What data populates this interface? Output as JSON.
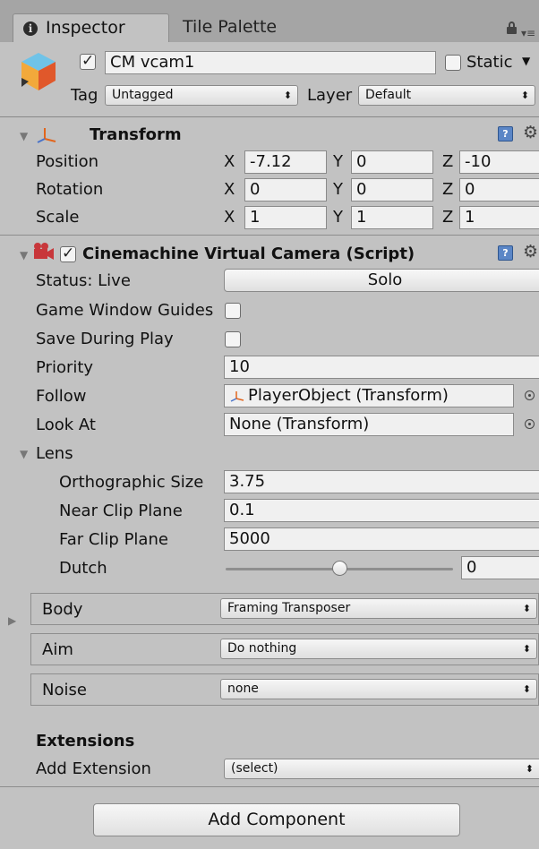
{
  "tabs": [
    {
      "label": "Inspector",
      "active": true
    },
    {
      "label": "Tile Palette",
      "active": false
    }
  ],
  "header": {
    "object_name": "CM vcam1",
    "active_checked": true,
    "static_label": "Static",
    "static_checked": false,
    "tag_label": "Tag",
    "tag_value": "Untagged",
    "layer_label": "Layer",
    "layer_value": "Default"
  },
  "transform": {
    "title": "Transform",
    "rows": [
      {
        "label": "Position",
        "x": "-7.12",
        "y": "0",
        "z": "-10"
      },
      {
        "label": "Rotation",
        "x": "0",
        "y": "0",
        "z": "0"
      },
      {
        "label": "Scale",
        "x": "1",
        "y": "1",
        "z": "1"
      }
    ],
    "axes": {
      "x": "X",
      "y": "Y",
      "z": "Z"
    }
  },
  "vcam": {
    "title": "Cinemachine Virtual Camera (Script)",
    "enabled": true,
    "status_label": "Status: Live",
    "solo_button": "Solo",
    "game_window_guides_label": "Game Window Guides",
    "game_window_guides_checked": false,
    "save_during_play_label": "Save During Play",
    "save_during_play_checked": false,
    "priority_label": "Priority",
    "priority_value": "10",
    "follow_label": "Follow",
    "follow_value": "PlayerObject (Transform)",
    "look_at_label": "Look At",
    "look_at_value": "None (Transform)",
    "lens_label": "Lens",
    "lens": {
      "ortho_label": "Orthographic Size",
      "ortho_value": "3.75",
      "near_label": "Near Clip Plane",
      "near_value": "0.1",
      "far_label": "Far Clip Plane",
      "far_value": "5000",
      "dutch_label": "Dutch",
      "dutch_value": "0",
      "dutch_fraction": 0.5
    },
    "body_label": "Body",
    "body_value": "Framing Transposer",
    "aim_label": "Aim",
    "aim_value": "Do nothing",
    "noise_label": "Noise",
    "noise_value": "none",
    "extensions_label": "Extensions",
    "add_extension_label": "Add Extension",
    "add_extension_value": "(select)"
  },
  "footer": {
    "add_component": "Add Component"
  },
  "colors": {
    "panel_bg": "#c2c2c2",
    "tabbar_bg": "#a5a5a5",
    "field_bg": "#f0f0f0",
    "help_blue": "#5b86c6"
  }
}
